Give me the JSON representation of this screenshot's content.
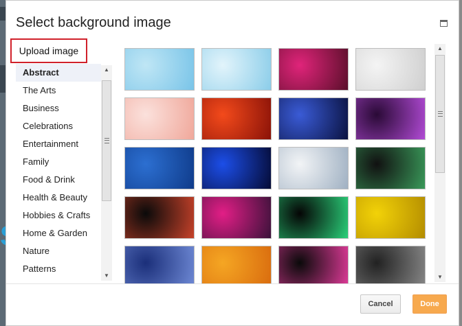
{
  "dialog": {
    "title": "Select background image",
    "upload_label": "Upload image",
    "cancel_label": "Cancel",
    "done_label": "Done"
  },
  "categories": [
    {
      "label": "Abstract",
      "selected": true
    },
    {
      "label": "The Arts"
    },
    {
      "label": "Business"
    },
    {
      "label": "Celebrations"
    },
    {
      "label": "Entertainment"
    },
    {
      "label": "Family"
    },
    {
      "label": "Food & Drink"
    },
    {
      "label": "Health & Beauty"
    },
    {
      "label": "Hobbies & Crafts"
    },
    {
      "label": "Home & Garden"
    },
    {
      "label": "Nature"
    },
    {
      "label": "Patterns"
    }
  ],
  "images": [
    {
      "name": "blue-sky-water",
      "colors": [
        "#bfe6f5",
        "#79c4e8"
      ]
    },
    {
      "name": "light-blue-sky",
      "colors": [
        "#e2f4fb",
        "#8bcde9"
      ]
    },
    {
      "name": "pink-bokeh",
      "colors": [
        "#e0247a",
        "#5a0f2a"
      ]
    },
    {
      "name": "silver-bokeh",
      "colors": [
        "#f4f4f4",
        "#cfcfcf"
      ]
    },
    {
      "name": "peach-bokeh",
      "colors": [
        "#fbe1dc",
        "#f0a79a"
      ]
    },
    {
      "name": "red-orange-sparkle",
      "colors": [
        "#f34a1b",
        "#8a1208"
      ]
    },
    {
      "name": "blue-light-streaks",
      "colors": [
        "#3a5bd6",
        "#0a1240"
      ]
    },
    {
      "name": "purple-lightning",
      "colors": [
        "#2a0a36",
        "#b24bd6"
      ]
    },
    {
      "name": "blue-vertical-lines",
      "colors": [
        "#2c6fd1",
        "#0f3b8a"
      ]
    },
    {
      "name": "blue-starburst",
      "colors": [
        "#1c4ee8",
        "#050b35"
      ]
    },
    {
      "name": "silver-swirl",
      "colors": [
        "#f2f4f6",
        "#9fb0c2"
      ]
    },
    {
      "name": "green-red-bokeh",
      "colors": [
        "#111111",
        "#3a9a5a"
      ]
    },
    {
      "name": "night-bokeh",
      "colors": [
        "#0a0a0a",
        "#c8422a"
      ]
    },
    {
      "name": "retro-stripes",
      "colors": [
        "#e21e86",
        "#3a123a"
      ]
    },
    {
      "name": "neon-swirls",
      "colors": [
        "#050505",
        "#2bd17a"
      ]
    },
    {
      "name": "yellow-scratch",
      "colors": [
        "#f2d208",
        "#b38c00"
      ]
    },
    {
      "name": "blue-curves",
      "colors": [
        "#1b2f7a",
        "#6f8ad6"
      ]
    },
    {
      "name": "orange-florals",
      "colors": [
        "#f5a623",
        "#d96b0e"
      ]
    },
    {
      "name": "rainbow-stripes",
      "colors": [
        "#0a0a0a",
        "#e23b9a"
      ]
    },
    {
      "name": "grey-damask",
      "colors": [
        "#222222",
        "#888888"
      ]
    }
  ]
}
